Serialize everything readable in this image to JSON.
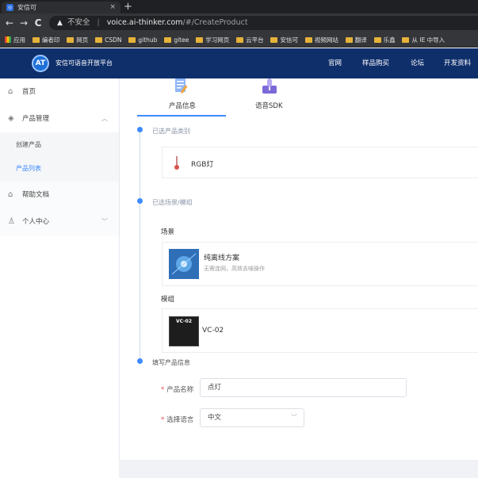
{
  "browser": {
    "tab_title": "安信可",
    "tab_close": "×",
    "new_tab": "+",
    "url_security": "不安全",
    "url_host": "voice.ai-thinker.com",
    "url_path": "/#/CreateProduct",
    "bookmarks": [
      "应用",
      "编者印",
      "网页",
      "CSDN",
      "github",
      "gitee",
      "学习网页",
      "云平台",
      "安信可",
      "视频网站",
      "翻译",
      "乐鑫",
      "从 IE 中导入"
    ]
  },
  "header": {
    "logo_text": "AT",
    "brand": "安信可语音开放平台",
    "nav": [
      "官网",
      "样品购买",
      "论坛",
      "开发资料"
    ]
  },
  "sidebar": {
    "home": "首页",
    "product_mgmt": "产品管理",
    "create_product": "创建产品",
    "product_list": "产品列表",
    "help_docs": "帮助文档",
    "personal_center": "个人中心"
  },
  "tabs": {
    "product_info": "产品信息",
    "voice_sdk": "语音SDK"
  },
  "steps": {
    "category_title": "已选产品类别",
    "category_value": "RGB灯",
    "scene_title": "已选场景/模组",
    "scene_label": "场景",
    "scene_name": "纯离线方案",
    "scene_desc": "无需连网，高效去噪操作",
    "module_label": "模组",
    "module_chip_text": "VC-02",
    "module_name": "VC-02",
    "fill_title": "填写产品信息"
  },
  "form": {
    "required_mark": "*",
    "name_label": "产品名称",
    "name_value": "点灯",
    "lang_label": "选择语言",
    "lang_value": "中文"
  },
  "colors": {
    "accent": "#3d8bfd",
    "header_bg": "#0f2f6b",
    "required": "#e84d4d"
  }
}
